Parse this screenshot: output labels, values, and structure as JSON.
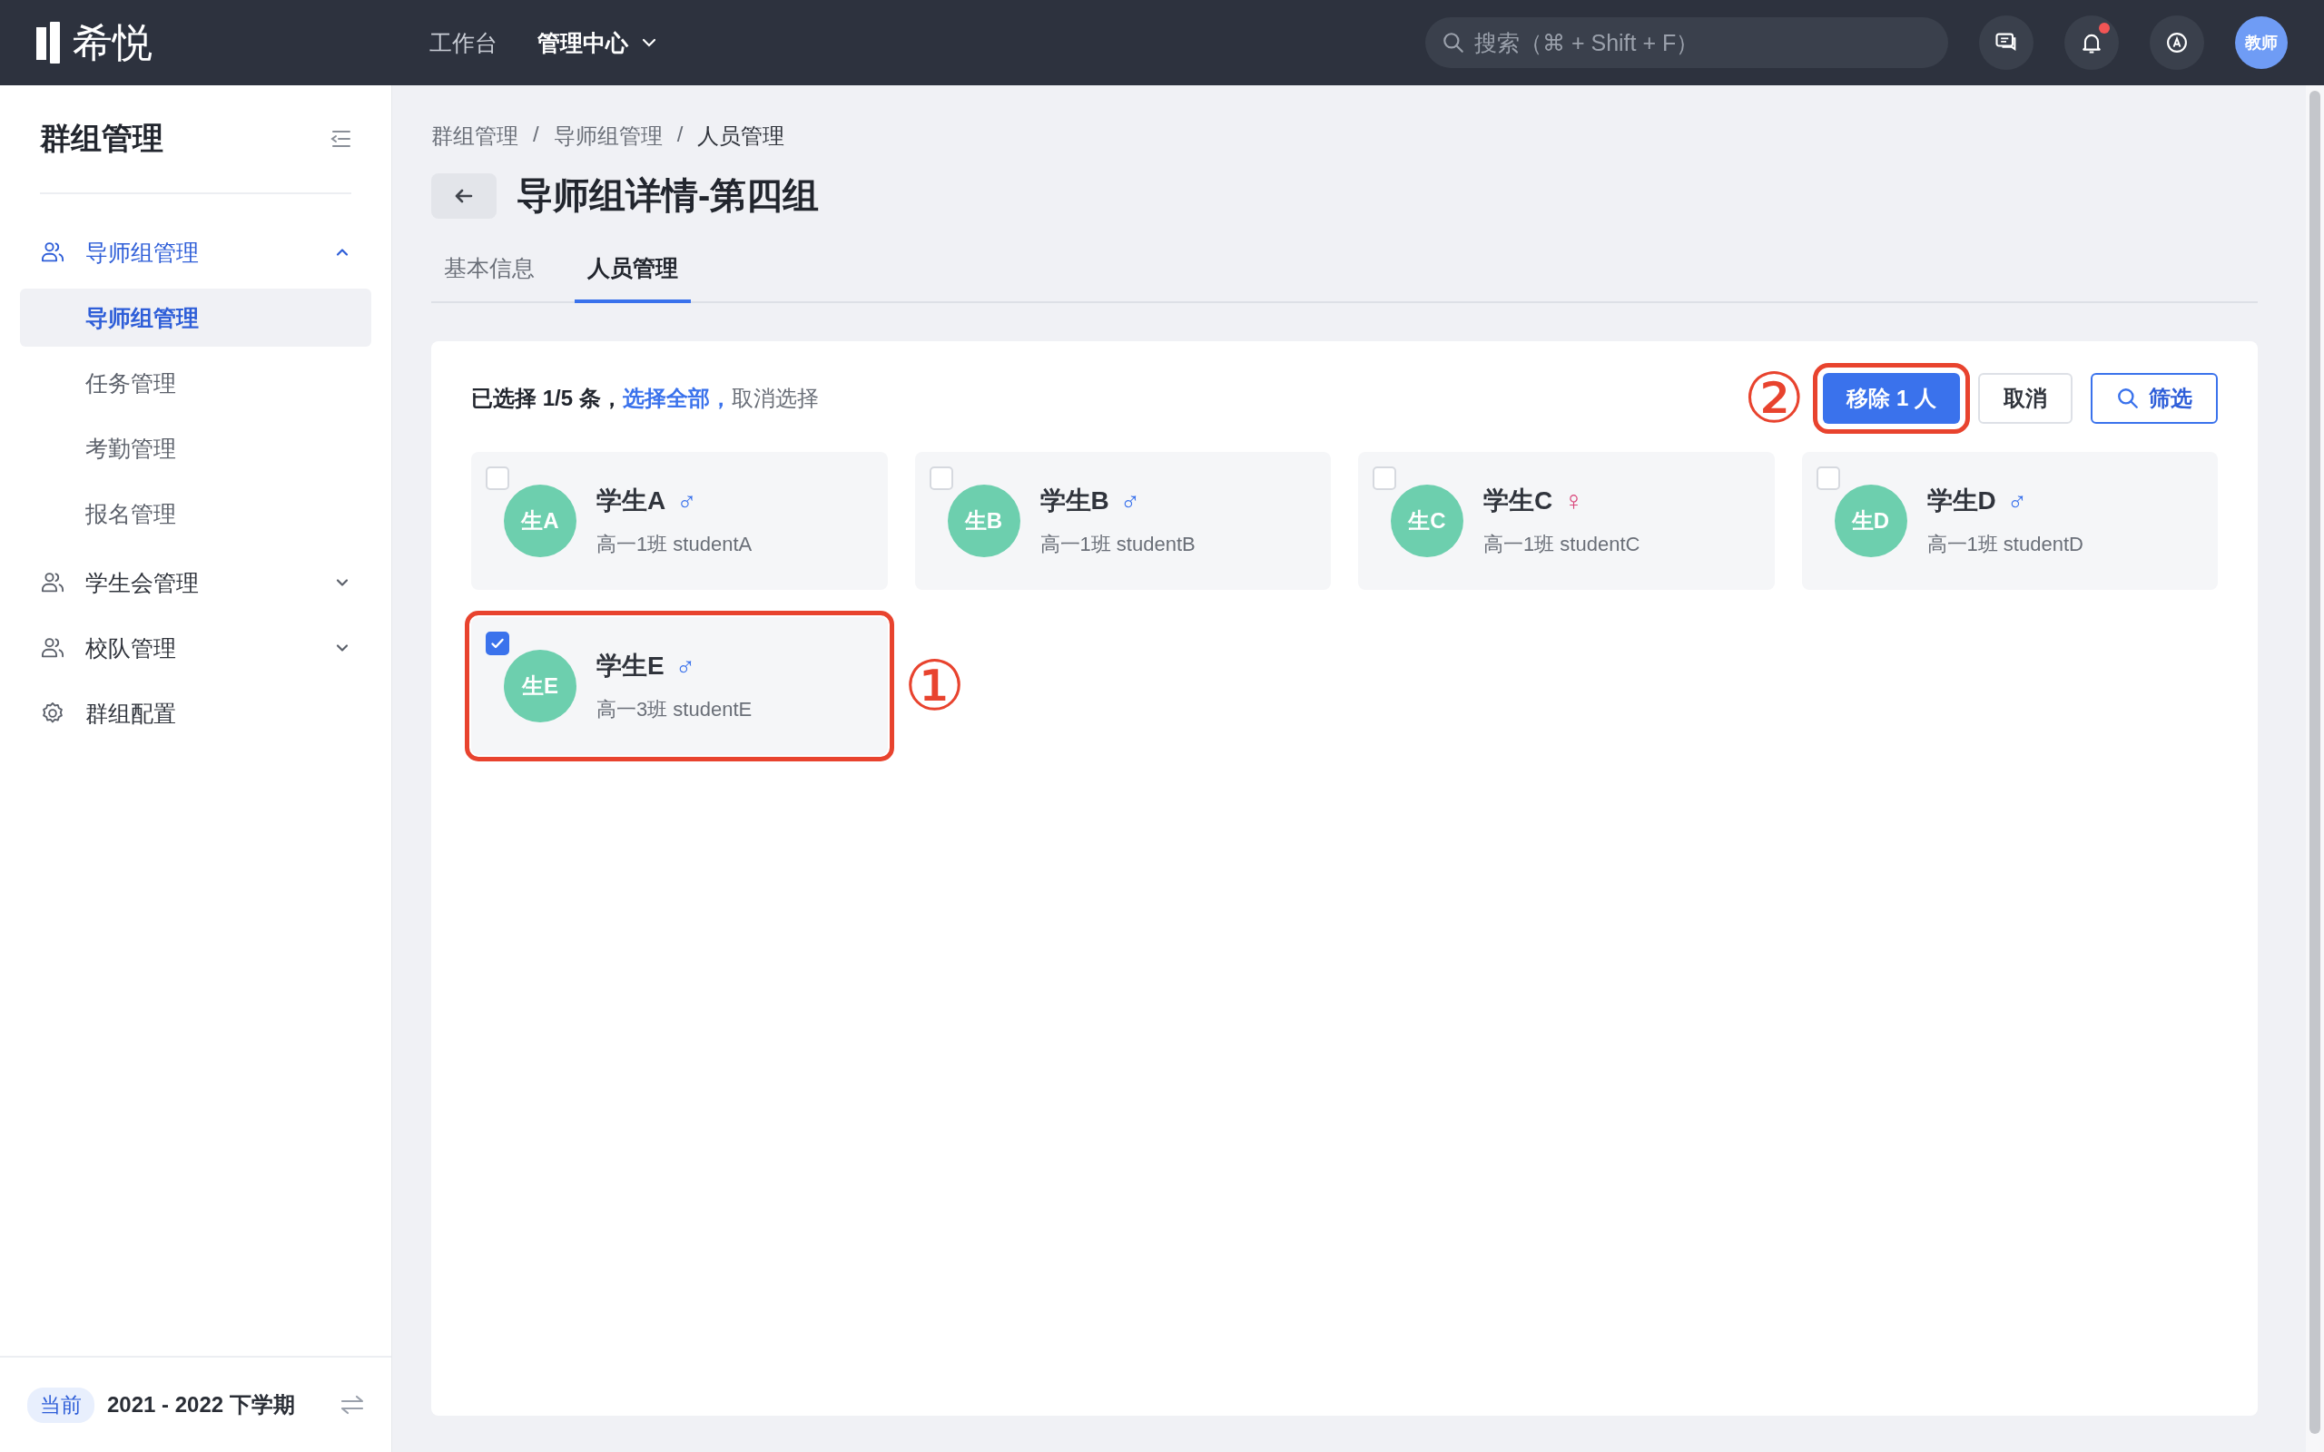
{
  "topbar": {
    "logo": "希悦",
    "nav": [
      {
        "label": "工作台",
        "selected": false,
        "dropdown": false
      },
      {
        "label": "管理中心",
        "selected": true,
        "dropdown": true
      }
    ],
    "search": {
      "placeholder": "搜索（⌘ + Shift + F）"
    },
    "notification_dot": true,
    "avatar": "教师"
  },
  "sidebar": {
    "title": "群组管理",
    "items": [
      {
        "label": "导师组管理",
        "kind": "people",
        "active": true,
        "expanded": true,
        "children": [
          {
            "label": "导师组管理",
            "selected": true
          },
          {
            "label": "任务管理",
            "selected": false
          },
          {
            "label": "考勤管理",
            "selected": false
          },
          {
            "label": "报名管理",
            "selected": false
          }
        ]
      },
      {
        "label": "学生会管理",
        "kind": "people",
        "active": false,
        "expanded": false
      },
      {
        "label": "校队管理",
        "kind": "people",
        "active": false,
        "expanded": false
      },
      {
        "label": "群组配置",
        "kind": "gear",
        "active": false
      }
    ],
    "term": {
      "badge": "当前",
      "label": "2021 - 2022 下学期"
    }
  },
  "breadcrumb": [
    {
      "kind": "link",
      "text": "群组管理"
    },
    {
      "kind": "separator",
      "text": "/"
    },
    {
      "kind": "link",
      "text": "导师组管理"
    },
    {
      "kind": "separator",
      "text": "/"
    },
    {
      "kind": "current",
      "text": "人员管理"
    }
  ],
  "title": "导师组详情-第四组",
  "tabs": [
    {
      "label": "基本信息",
      "selected": false
    },
    {
      "label": "人员管理",
      "selected": true
    }
  ],
  "selection": {
    "text": "已选择 1/5 条，",
    "select_all": "选择全部，",
    "clear": "取消选择"
  },
  "actions": [
    {
      "label": "移除 1 人",
      "kind": "primary",
      "annotation": "②"
    },
    {
      "label": "取消",
      "kind": "default"
    },
    {
      "label": "筛选",
      "kind": "search"
    }
  ],
  "members": [
    {
      "avatar": "生A",
      "name": "学生A",
      "color": "#3a72ec",
      "gender_symbol": "♂",
      "info": "高一1班 studentA",
      "checked": false
    },
    {
      "avatar": "生B",
      "name": "学生B",
      "color": "#3a72ec",
      "gender_symbol": "♂",
      "info": "高一1班 studentB",
      "checked": false
    },
    {
      "avatar": "生C",
      "name": "学生C",
      "color": "#d9467a",
      "gender_symbol": "♀",
      "info": "高一1班 studentC",
      "checked": false
    },
    {
      "avatar": "生D",
      "name": "学生D",
      "color": "#3a72ec",
      "gender_symbol": "♂",
      "info": "高一1班 studentD",
      "checked": false
    },
    {
      "avatar": "生E",
      "name": "学生E",
      "color": "#3a72ec",
      "gender_symbol": "♂",
      "info": "高一3班 studentE",
      "checked": true,
      "annotation": "①"
    }
  ]
}
